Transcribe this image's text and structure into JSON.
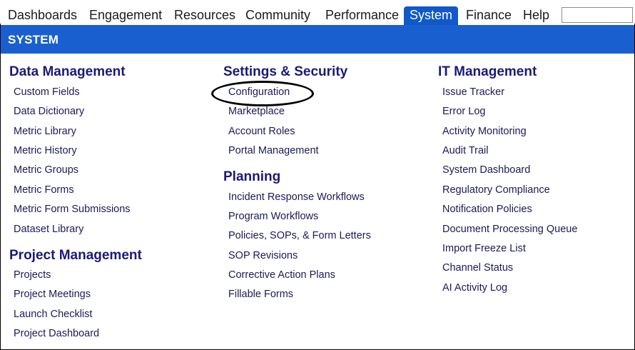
{
  "nav": {
    "items": [
      "Dashboards",
      "Engagement",
      "Resources",
      "Community",
      "Performance",
      "System",
      "Finance",
      "Help"
    ],
    "active": "System",
    "search_placeholder": ""
  },
  "section": {
    "title": "SYSTEM"
  },
  "columns": {
    "data_management": {
      "heading": "Data Management",
      "links": [
        "Custom Fields",
        "Data Dictionary",
        "Metric Library",
        "Metric History",
        "Metric Groups",
        "Metric Forms",
        "Metric Form Submissions",
        "Dataset Library"
      ]
    },
    "project_management": {
      "heading": "Project Management",
      "links": [
        "Projects",
        "Project Meetings",
        "Launch Checklist",
        "Project Dashboard"
      ]
    },
    "settings_security": {
      "heading": "Settings & Security",
      "links": [
        "Configuration",
        "Marketplace",
        "Account Roles",
        "Portal Management"
      ]
    },
    "planning": {
      "heading": "Planning",
      "links": [
        "Incident Response Workflows",
        "Program Workflows",
        "Policies, SOPs, & Form Letters",
        "SOP Revisions",
        "Corrective Action Plans",
        "Fillable Forms"
      ]
    },
    "it_management": {
      "heading": "IT Management",
      "links": [
        "Issue Tracker",
        "Error Log",
        "Activity Monitoring",
        "Audit Trail",
        "System Dashboard",
        "Regulatory Compliance",
        "Notification Policies",
        "Document Processing Queue",
        "Import Freeze List",
        "Channel Status",
        "AI Activity Log"
      ]
    }
  },
  "colors": {
    "nav_active": "#1158c9",
    "section_bar": "#1a5fcf",
    "heading": "#1a1a7a",
    "link": "#1a1a5a"
  }
}
